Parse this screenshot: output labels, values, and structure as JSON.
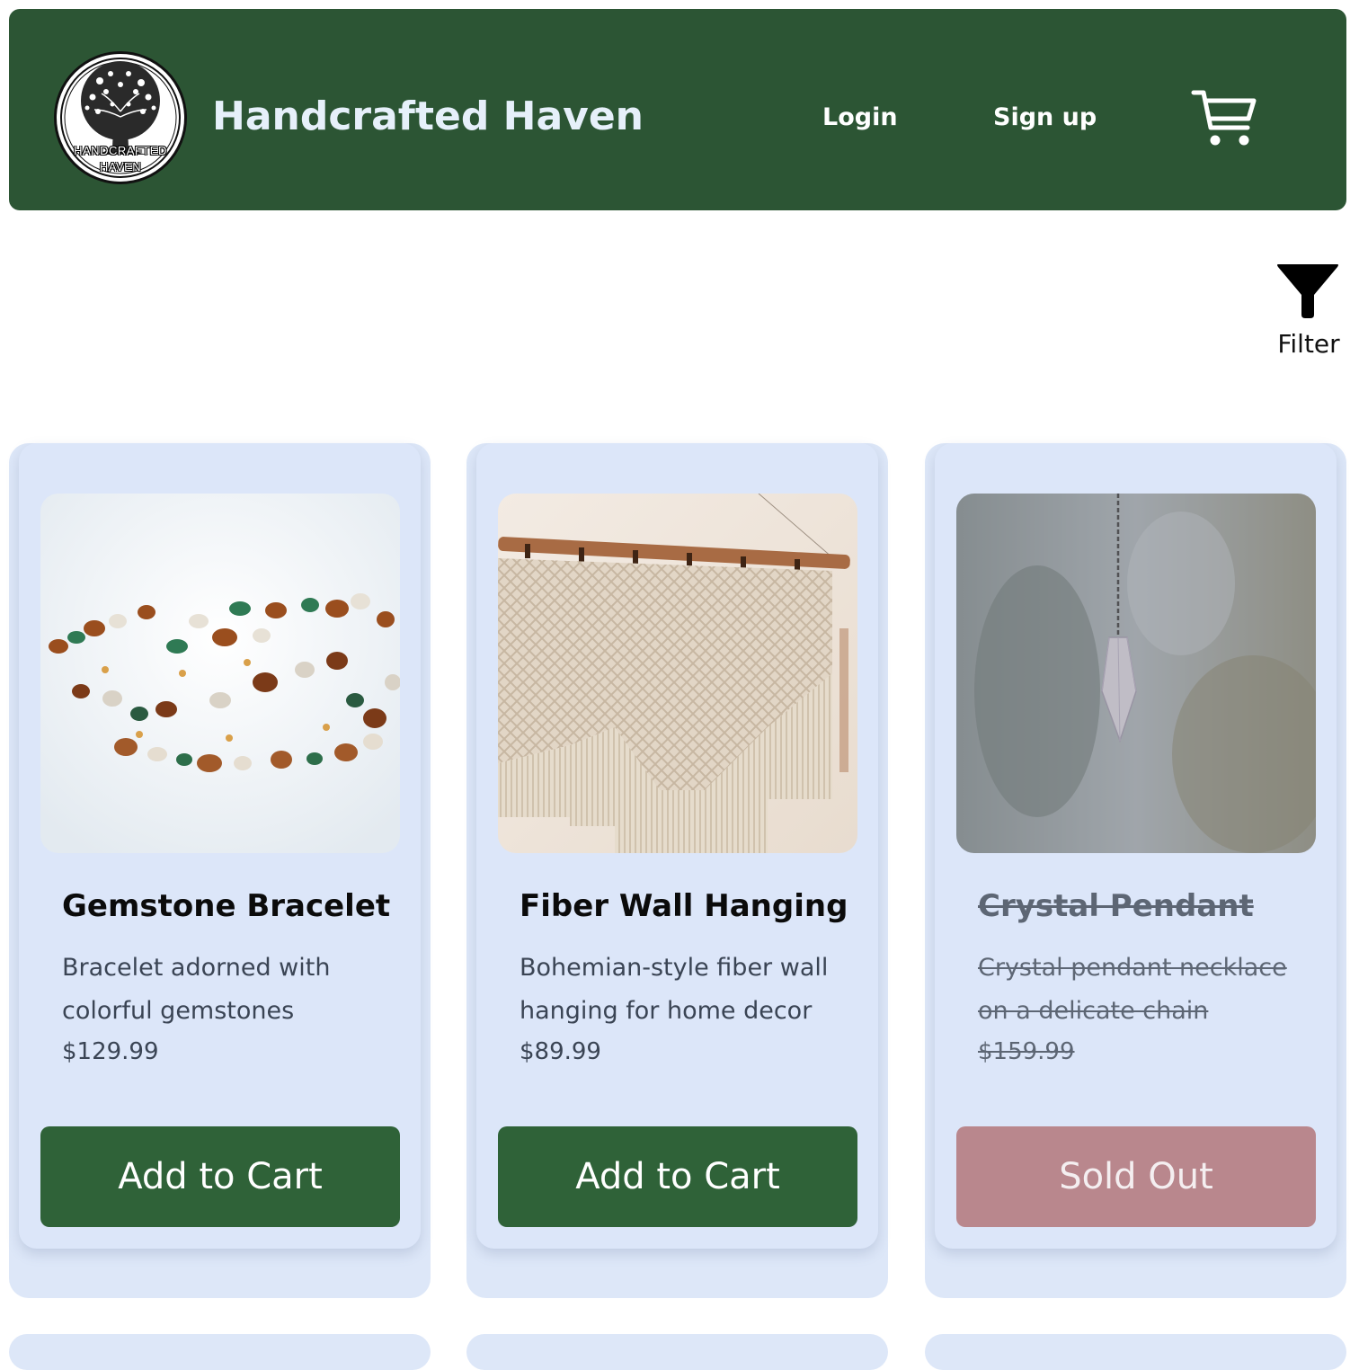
{
  "header": {
    "brand": "Handcrafted Haven",
    "logo_text_line1": "HANDCRAFTED",
    "logo_text_line2": "HAVEN",
    "login_label": "Login",
    "signup_label": "Sign up",
    "cart_icon": "shopping-cart-icon",
    "background_color": "#2c5534"
  },
  "filter": {
    "label": "Filter",
    "icon": "funnel-icon"
  },
  "products": [
    {
      "name": "Gemstone Bracelet",
      "description": "Bracelet adorned with colorful gemstones",
      "price": "$129.99",
      "button_label": "Add to Cart",
      "sold_out": false
    },
    {
      "name": "Fiber Wall Hanging",
      "description": "Bohemian-style fiber wall hanging for home decor",
      "price": "$89.99",
      "button_label": "Add to Cart",
      "sold_out": false
    },
    {
      "name": "Crystal Pendant",
      "description": "Crystal pendant necklace on a delicate chain",
      "price": "$159.99",
      "button_label": "Sold Out",
      "sold_out": true
    }
  ],
  "colors": {
    "accent_green": "#2f6238",
    "sold_out": "#b9878d",
    "card_background": "#dce6f9"
  }
}
